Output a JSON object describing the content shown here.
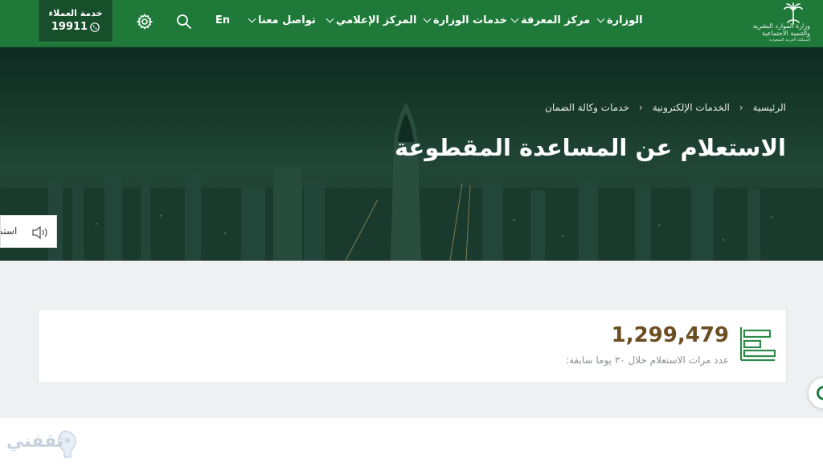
{
  "header": {
    "logo_lines": [
      "وزارة الموارد البشرية",
      "والتنمية الاجتماعية",
      "المملكة العربية السعودية"
    ],
    "nav": [
      {
        "label": "الوزارة"
      },
      {
        "label": "مركز المعرفة"
      },
      {
        "label": "خدمات الوزارة"
      },
      {
        "label": "المركز الإعلامي"
      },
      {
        "label": "تواصل معنا"
      }
    ],
    "lang_label": "En",
    "support_title": "خدمة العملاء",
    "support_number": "19911",
    "colors": {
      "primary": "#1f7a3a",
      "support_bg": "#174f2a"
    }
  },
  "hero": {
    "breadcrumb": [
      "الرئيسية",
      "الخدمات الإلكترونية",
      "خدمات وكالة الضمان"
    ],
    "title": "الاستعلام عن المساعدة المقطوعة",
    "listen_label": "استمع"
  },
  "stats": {
    "count": "1,299,479",
    "label": "عدد مرات الاستعلام خلال ٣٠ يوما سابقة:",
    "number_color": "#6b4e22"
  },
  "watermark": {
    "text": "ثقفني"
  }
}
